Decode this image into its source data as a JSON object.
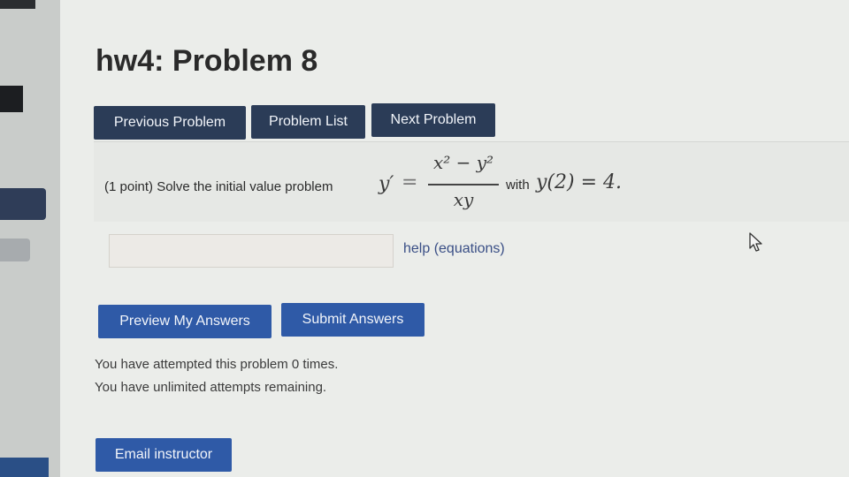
{
  "page": {
    "title": "hw4: Problem 8"
  },
  "nav": {
    "previous_label": "Previous Problem",
    "list_label": "Problem List",
    "next_label": "Next Problem"
  },
  "problem": {
    "prefix": "(1 point) Solve the initial value problem",
    "lhs": "y′",
    "equals": "=",
    "numerator": "x² − y²",
    "denominator": "xy",
    "with_text": "with",
    "condition": "y(2) = 4."
  },
  "answer": {
    "value": "",
    "help_label": "help (equations)"
  },
  "actions": {
    "preview_label": "Preview My Answers",
    "submit_label": "Submit Answers",
    "email_label": "Email instructor"
  },
  "status": {
    "attempted": "You have attempted this problem 0 times.",
    "remaining": "You have unlimited attempts remaining."
  },
  "icons": {
    "cursor": "mouse-pointer-icon"
  },
  "colors": {
    "dark_button": "#2b3c57",
    "blue_button": "#2f5aa7",
    "link": "#3a4f86"
  }
}
